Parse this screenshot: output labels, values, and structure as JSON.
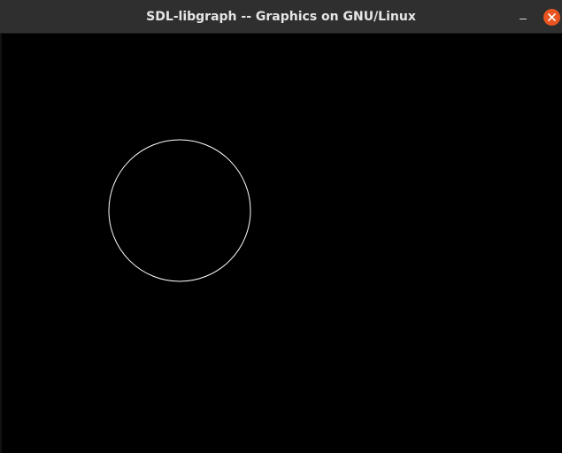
{
  "window": {
    "title": "SDL-libgraph -- Graphics on GNU/Linux",
    "controls": {
      "minimize_icon": "minimize-icon",
      "close_icon": "close-icon",
      "close_color": "#e95420"
    }
  },
  "canvas": {
    "background": "#000000",
    "shapes": [
      {
        "type": "circle",
        "stroke": "#ffffff",
        "fill": "none"
      }
    ]
  }
}
